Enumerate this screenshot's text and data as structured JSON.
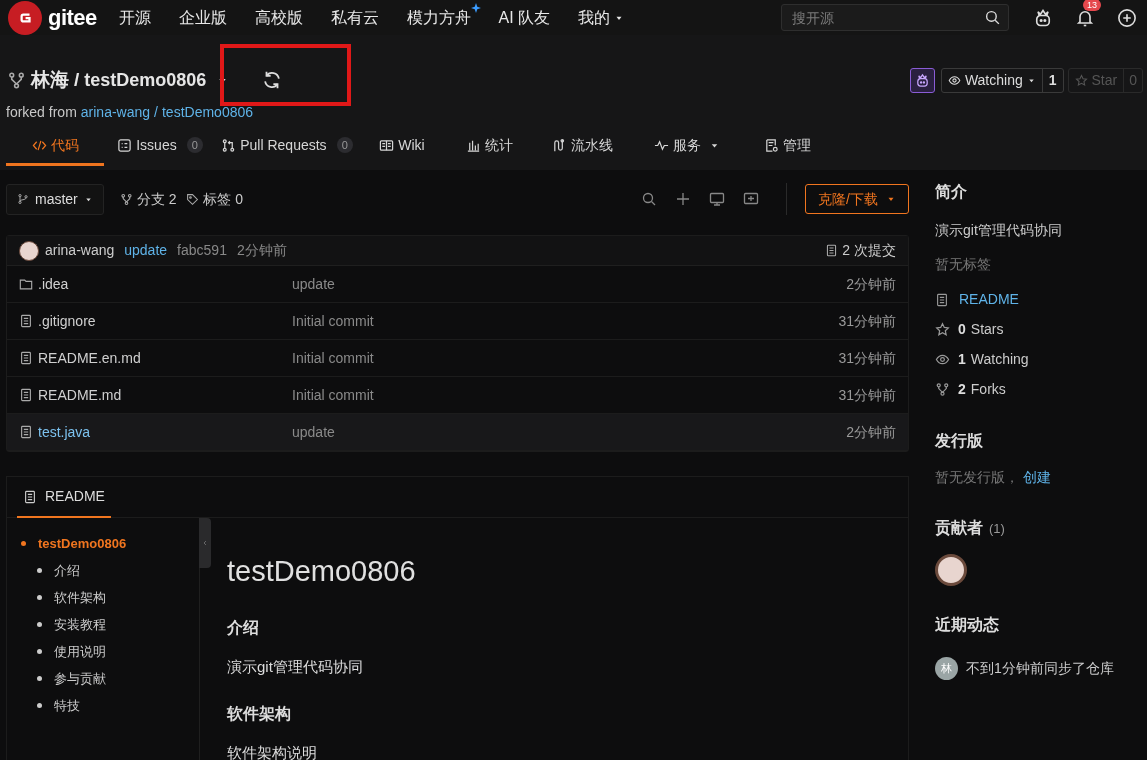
{
  "nav": {
    "logo": "gitee",
    "links": [
      {
        "label": "开源",
        "dropdown": false
      },
      {
        "label": "企业版",
        "dropdown": false
      },
      {
        "label": "高校版",
        "dropdown": false
      },
      {
        "label": "私有云",
        "dropdown": false
      },
      {
        "label": "模力方舟",
        "dropdown": false
      },
      {
        "label": "AI 队友",
        "dropdown": false
      },
      {
        "label": "我的",
        "dropdown": true
      }
    ],
    "search": {
      "placeholder": "搜开源"
    },
    "notification_count": "13"
  },
  "repo": {
    "owner": "林海",
    "separator": "/",
    "name": "testDemo0806",
    "forked_label": "forked from",
    "fork_owner": "arina-wang",
    "fork_sep": "/",
    "fork_repo": "testDemo0806",
    "watch": {
      "label": "Watching",
      "count": "1"
    },
    "star": {
      "label": "Star",
      "count": "0",
      "disabled": true
    }
  },
  "tabs": [
    {
      "label": "代码",
      "selected": true
    },
    {
      "label": "Issues",
      "count": "0",
      "selected": false
    },
    {
      "label": "Pull Requests",
      "count": "0",
      "selected": false
    },
    {
      "label": "Wiki",
      "selected": false
    },
    {
      "label": "统计",
      "selected": false
    },
    {
      "label": "流水线",
      "selected": false
    },
    {
      "label": "服务",
      "dropdown": true,
      "selected": false
    },
    {
      "label": "管理",
      "selected": false
    }
  ],
  "toolbar": {
    "branch": "master",
    "branches": "分支 2",
    "tags": "标签 0",
    "clone": "克隆/下载"
  },
  "commit": {
    "author": "arina-wang",
    "message": "update",
    "hash": "fabc591",
    "time": "2分钟前",
    "commits": "2 次提交"
  },
  "files": [
    {
      "kind": "folder",
      "name": ".idea",
      "message": "update",
      "time": "2分钟前",
      "hovered": false
    },
    {
      "kind": "file",
      "name": ".gitignore",
      "message": "Initial commit",
      "time": "31分钟前",
      "hovered": false
    },
    {
      "kind": "file",
      "name": "README.en.md",
      "message": "Initial commit",
      "time": "31分钟前",
      "hovered": false
    },
    {
      "kind": "file",
      "name": "README.md",
      "message": "Initial commit",
      "time": "31分钟前",
      "hovered": false
    },
    {
      "kind": "file",
      "name": "test.java",
      "message": "update",
      "time": "2分钟前",
      "hovered": true
    }
  ],
  "readme": {
    "tab": "README",
    "toc": [
      {
        "label": "testDemo0806",
        "selected": true,
        "children": [
          {
            "label": "介绍",
            "selected": false
          },
          {
            "label": "软件架构",
            "selected": false
          },
          {
            "label": "安装教程",
            "selected": false
          },
          {
            "label": "使用说明",
            "selected": false
          },
          {
            "label": "参与贡献",
            "selected": false
          },
          {
            "label": "特技",
            "selected": false
          }
        ]
      }
    ],
    "content": [
      {
        "kind": "h1",
        "text": "testDemo0806"
      },
      {
        "kind": "h2",
        "text": "介绍"
      },
      {
        "kind": "p",
        "text": "演示git管理代码协同"
      },
      {
        "kind": "h2",
        "text": "软件架构"
      },
      {
        "kind": "p",
        "text": "软件架构说明"
      }
    ]
  },
  "sidebar": {
    "intro_title": "简介",
    "description": "演示git管理代码协同",
    "no_tags": "暂无标签",
    "readme_link": "README",
    "stats": [
      {
        "kind": "stars",
        "count": "0",
        "label": "Stars"
      },
      {
        "kind": "watching",
        "count": "1",
        "label": "Watching"
      },
      {
        "kind": "forks",
        "count": "2",
        "label": "Forks"
      }
    ],
    "release_title": "发行版",
    "no_release": "暂无发行版，",
    "create_link": "创建",
    "contributors_title": "贡献者",
    "contributors_count": "(1)",
    "activity_title": "近期动态",
    "activity_avatar": "林",
    "activity_text": "不到1分钟前同步了仓库"
  }
}
